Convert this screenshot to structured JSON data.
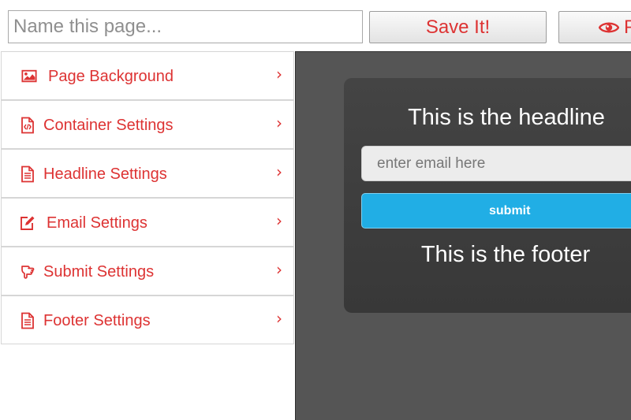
{
  "topbar": {
    "name_placeholder": "Name this page...",
    "save_label": "Save It!",
    "preview_label": "P",
    "accent_color": "#dd3333"
  },
  "sidebar": {
    "items": [
      {
        "label": "Page Background",
        "icon": "image-icon",
        "chevron": "›"
      },
      {
        "label": "Container Settings",
        "icon": "code-file-icon",
        "chevron": "›"
      },
      {
        "label": "Headline Settings",
        "icon": "text-file-icon",
        "chevron": "›"
      },
      {
        "label": "Email Settings",
        "icon": "edit-icon",
        "chevron": "›"
      },
      {
        "label": "Submit Settings",
        "icon": "hand-pointer-icon",
        "chevron": "›"
      },
      {
        "label": "Footer Settings",
        "icon": "text-file-icon",
        "chevron": "›"
      }
    ]
  },
  "preview": {
    "headline": "This is the headline",
    "email_placeholder": "enter email here",
    "submit_label": "submit",
    "footer": "This is the footer",
    "submit_color": "#21aee5"
  }
}
